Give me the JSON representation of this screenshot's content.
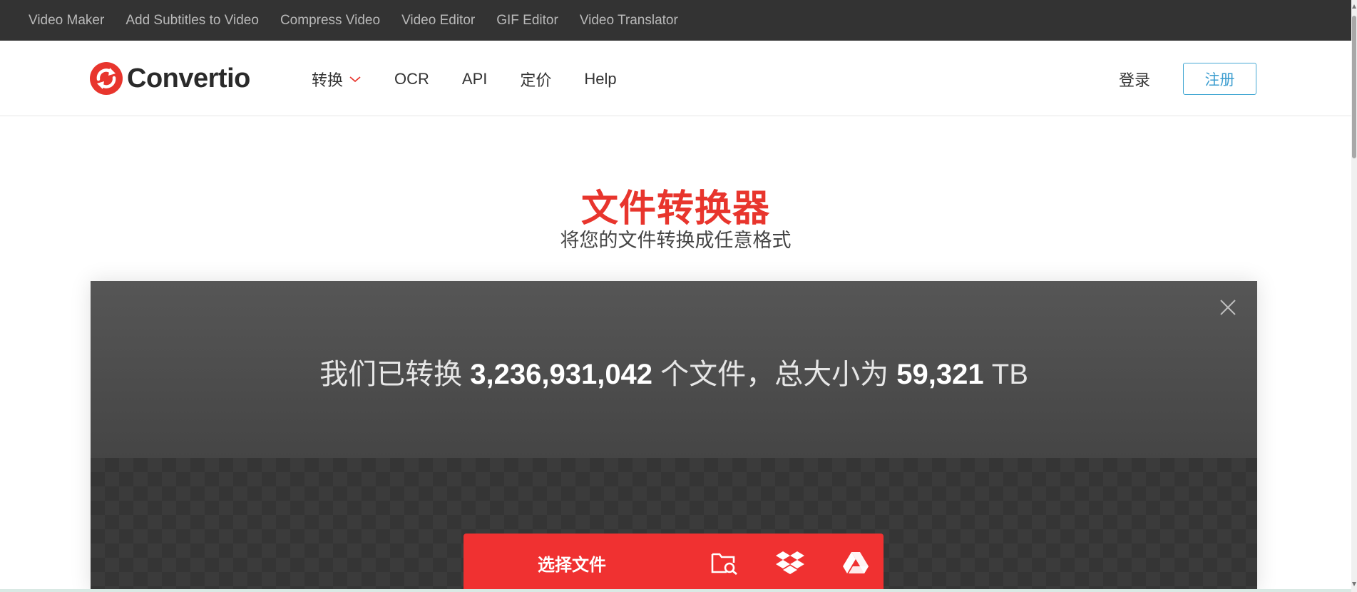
{
  "topbar": {
    "links": [
      "Video Maker",
      "Add Subtitles to Video",
      "Compress Video",
      "Video Editor",
      "GIF Editor",
      "Video Translator"
    ]
  },
  "nav": {
    "logo_text": "Convertio",
    "menu": {
      "convert": "转换",
      "ocr": "OCR",
      "api": "API",
      "pricing": "定价",
      "help": "Help"
    },
    "login": "登录",
    "signup": "注册"
  },
  "hero": {
    "title": "文件转换器",
    "subtitle": "将您的文件转换成任意格式"
  },
  "stats": {
    "prefix": "我们已转换 ",
    "files_count": "3,236,931,042",
    "middle": " 个文件，总大小为 ",
    "total_size": "59,321",
    "unit": " TB"
  },
  "upload": {
    "choose_files": "选择文件"
  },
  "colors": {
    "brand_red": "#e8352d",
    "upload_red": "#f03131",
    "signup_blue": "#46a9d4",
    "topbar_bg": "#333333"
  },
  "icons": {
    "logo": "convertio-logo-icon",
    "convert_dropdown": "chevron-down-icon",
    "close": "close-icon",
    "browse": "folder-search-icon",
    "dropbox": "dropbox-icon",
    "google_drive": "google-drive-icon"
  }
}
